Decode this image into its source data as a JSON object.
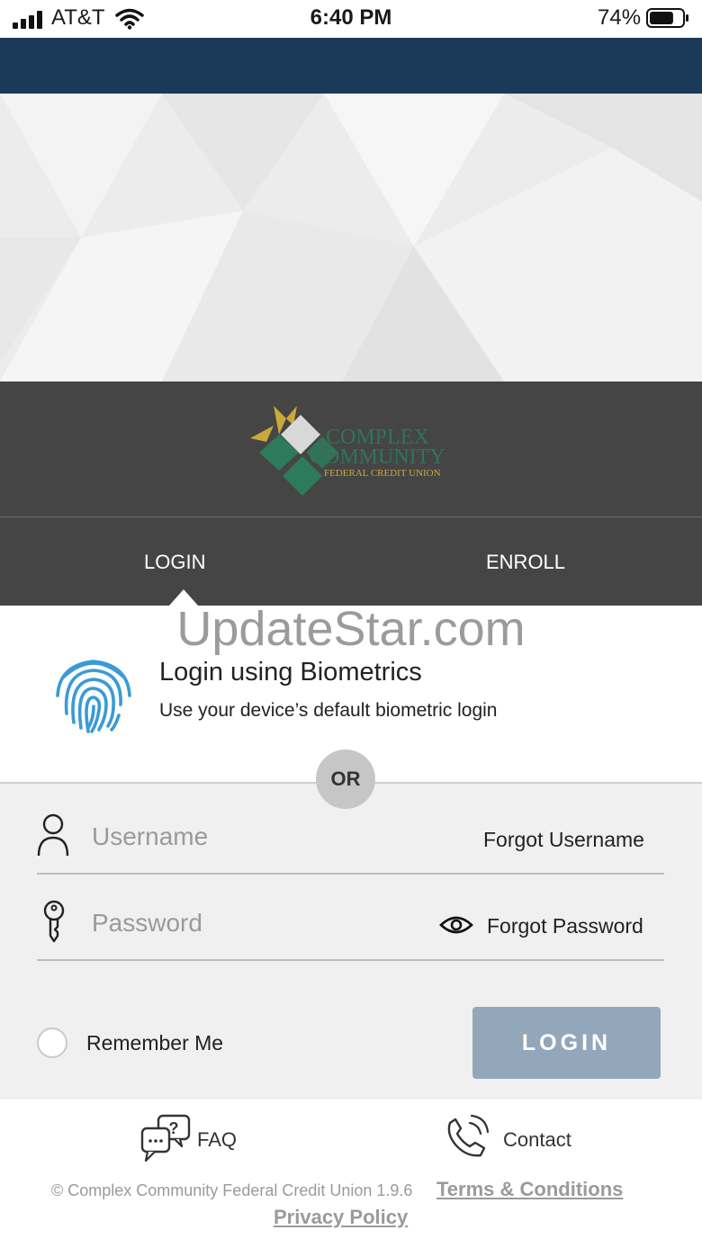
{
  "status_bar": {
    "carrier": "AT&T",
    "time": "6:40 PM",
    "battery_percent": "74%",
    "battery_level": 0.74,
    "signal_icon": "cellular-signal-icon",
    "wifi_icon": "wifi-icon",
    "battery_icon": "battery-icon"
  },
  "brand": {
    "logo_line1": "COMPLEX",
    "logo_line2": "COMMUNITY",
    "logo_line3": "FEDERAL CREDIT UNION",
    "colors": {
      "navbar": "#1b3a5a",
      "brand_bg": "#454545",
      "logo_green": "#2e7a5c",
      "logo_gold": "#c9a93a"
    }
  },
  "tabs": [
    {
      "label": "LOGIN",
      "active": true
    },
    {
      "label": "ENROLL",
      "active": false
    }
  ],
  "watermark": "UpdateStar.com",
  "biometrics": {
    "icon": "fingerprint-icon",
    "title": "Login using Biometrics",
    "subtitle": "Use your device’s default biometric login"
  },
  "or_label": "OR",
  "form": {
    "username": {
      "value": "",
      "placeholder": "Username",
      "icon": "user-icon"
    },
    "forgot_username": "Forgot Username",
    "password": {
      "value": "",
      "placeholder": "Password",
      "icon": "key-icon"
    },
    "show_password_icon": "eye-icon",
    "forgot_password": "Forgot Password",
    "remember_me": {
      "label": "Remember Me",
      "checked": false
    },
    "login_button": "LOGIN",
    "login_button_color": "#93a7ba"
  },
  "footer": {
    "faq": {
      "label": "FAQ",
      "icon": "faq-chat-icon"
    },
    "contact": {
      "label": "Contact",
      "icon": "phone-icon"
    },
    "copyright": "© Complex Community Federal Credit Union 1.9.6",
    "terms": "Terms & Conditions",
    "privacy": "Privacy Policy"
  }
}
